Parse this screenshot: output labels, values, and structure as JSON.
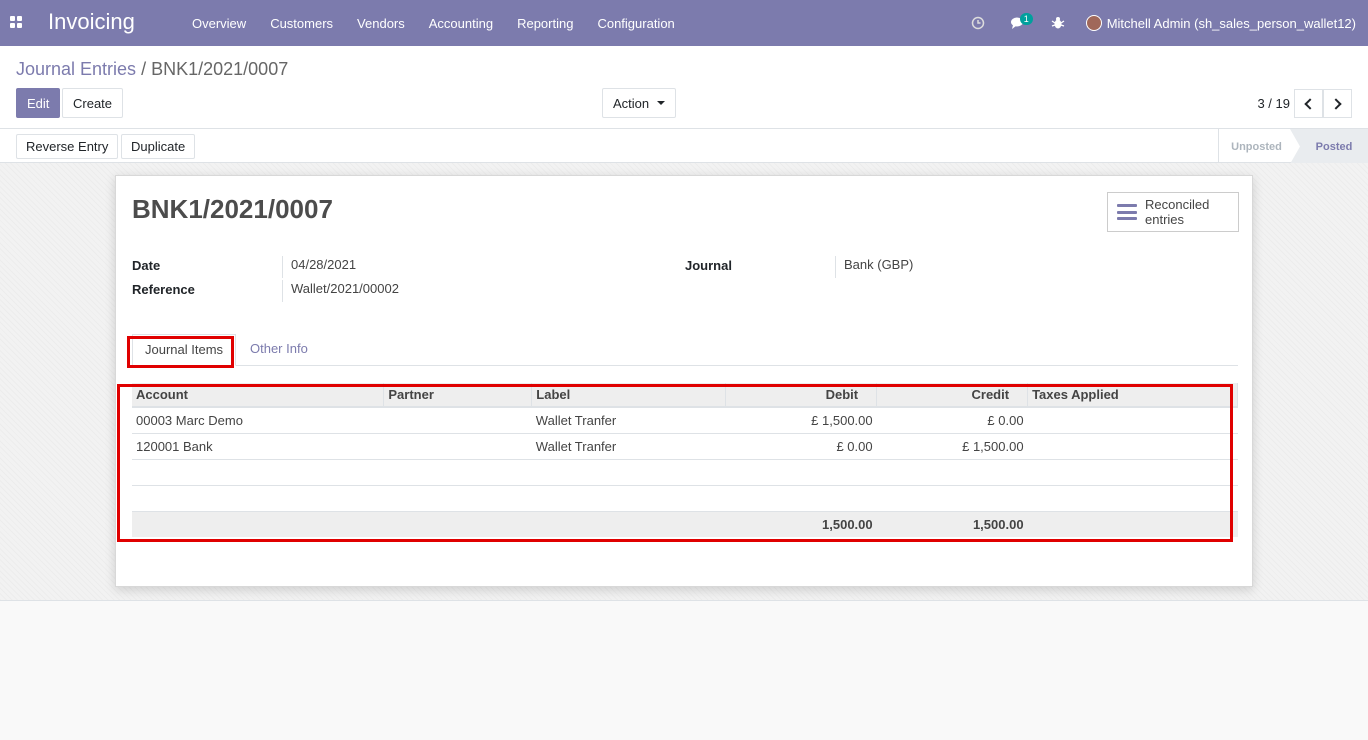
{
  "navbar": {
    "app_title": "Invoicing",
    "menu": [
      "Overview",
      "Customers",
      "Vendors",
      "Accounting",
      "Reporting",
      "Configuration"
    ],
    "messages_badge": "1",
    "user_name": "Mitchell Admin (sh_sales_person_wallet12)"
  },
  "breadcrumb": {
    "parent": "Journal Entries",
    "separator": "/",
    "current": "BNK1/2021/0007"
  },
  "toolbar": {
    "edit_label": "Edit",
    "create_label": "Create",
    "action_label": "Action",
    "pager_value": "3 / 19"
  },
  "status_bar": {
    "reverse_label": "Reverse Entry",
    "duplicate_label": "Duplicate",
    "stages": [
      "Unposted",
      "Posted"
    ],
    "current_stage": "Posted"
  },
  "form": {
    "title": "BNK1/2021/0007",
    "smart_button": [
      "Reconciled",
      "entries"
    ],
    "date_label": "Date",
    "date_value": "04/28/2021",
    "reference_label": "Reference",
    "reference_value": "Wallet/2021/00002",
    "journal_label": "Journal",
    "journal_value": "Bank (GBP)",
    "tabs": [
      "Journal Items",
      "Other Info"
    ]
  },
  "table": {
    "headers": [
      "Account",
      "Partner",
      "Label",
      "Debit",
      "Credit",
      "Taxes Applied"
    ],
    "rows": [
      [
        "00003 Marc Demo",
        "",
        "Wallet Tranfer",
        "£ 1,500.00",
        "£ 0.00",
        ""
      ],
      [
        "120001 Bank",
        "",
        "Wallet Tranfer",
        "£ 0.00",
        "£ 1,500.00",
        ""
      ]
    ],
    "total_debit": "1,500.00",
    "total_credit": "1,500.00"
  },
  "colors": {
    "brand": "#7c7bad",
    "highlight": "#e00000"
  }
}
